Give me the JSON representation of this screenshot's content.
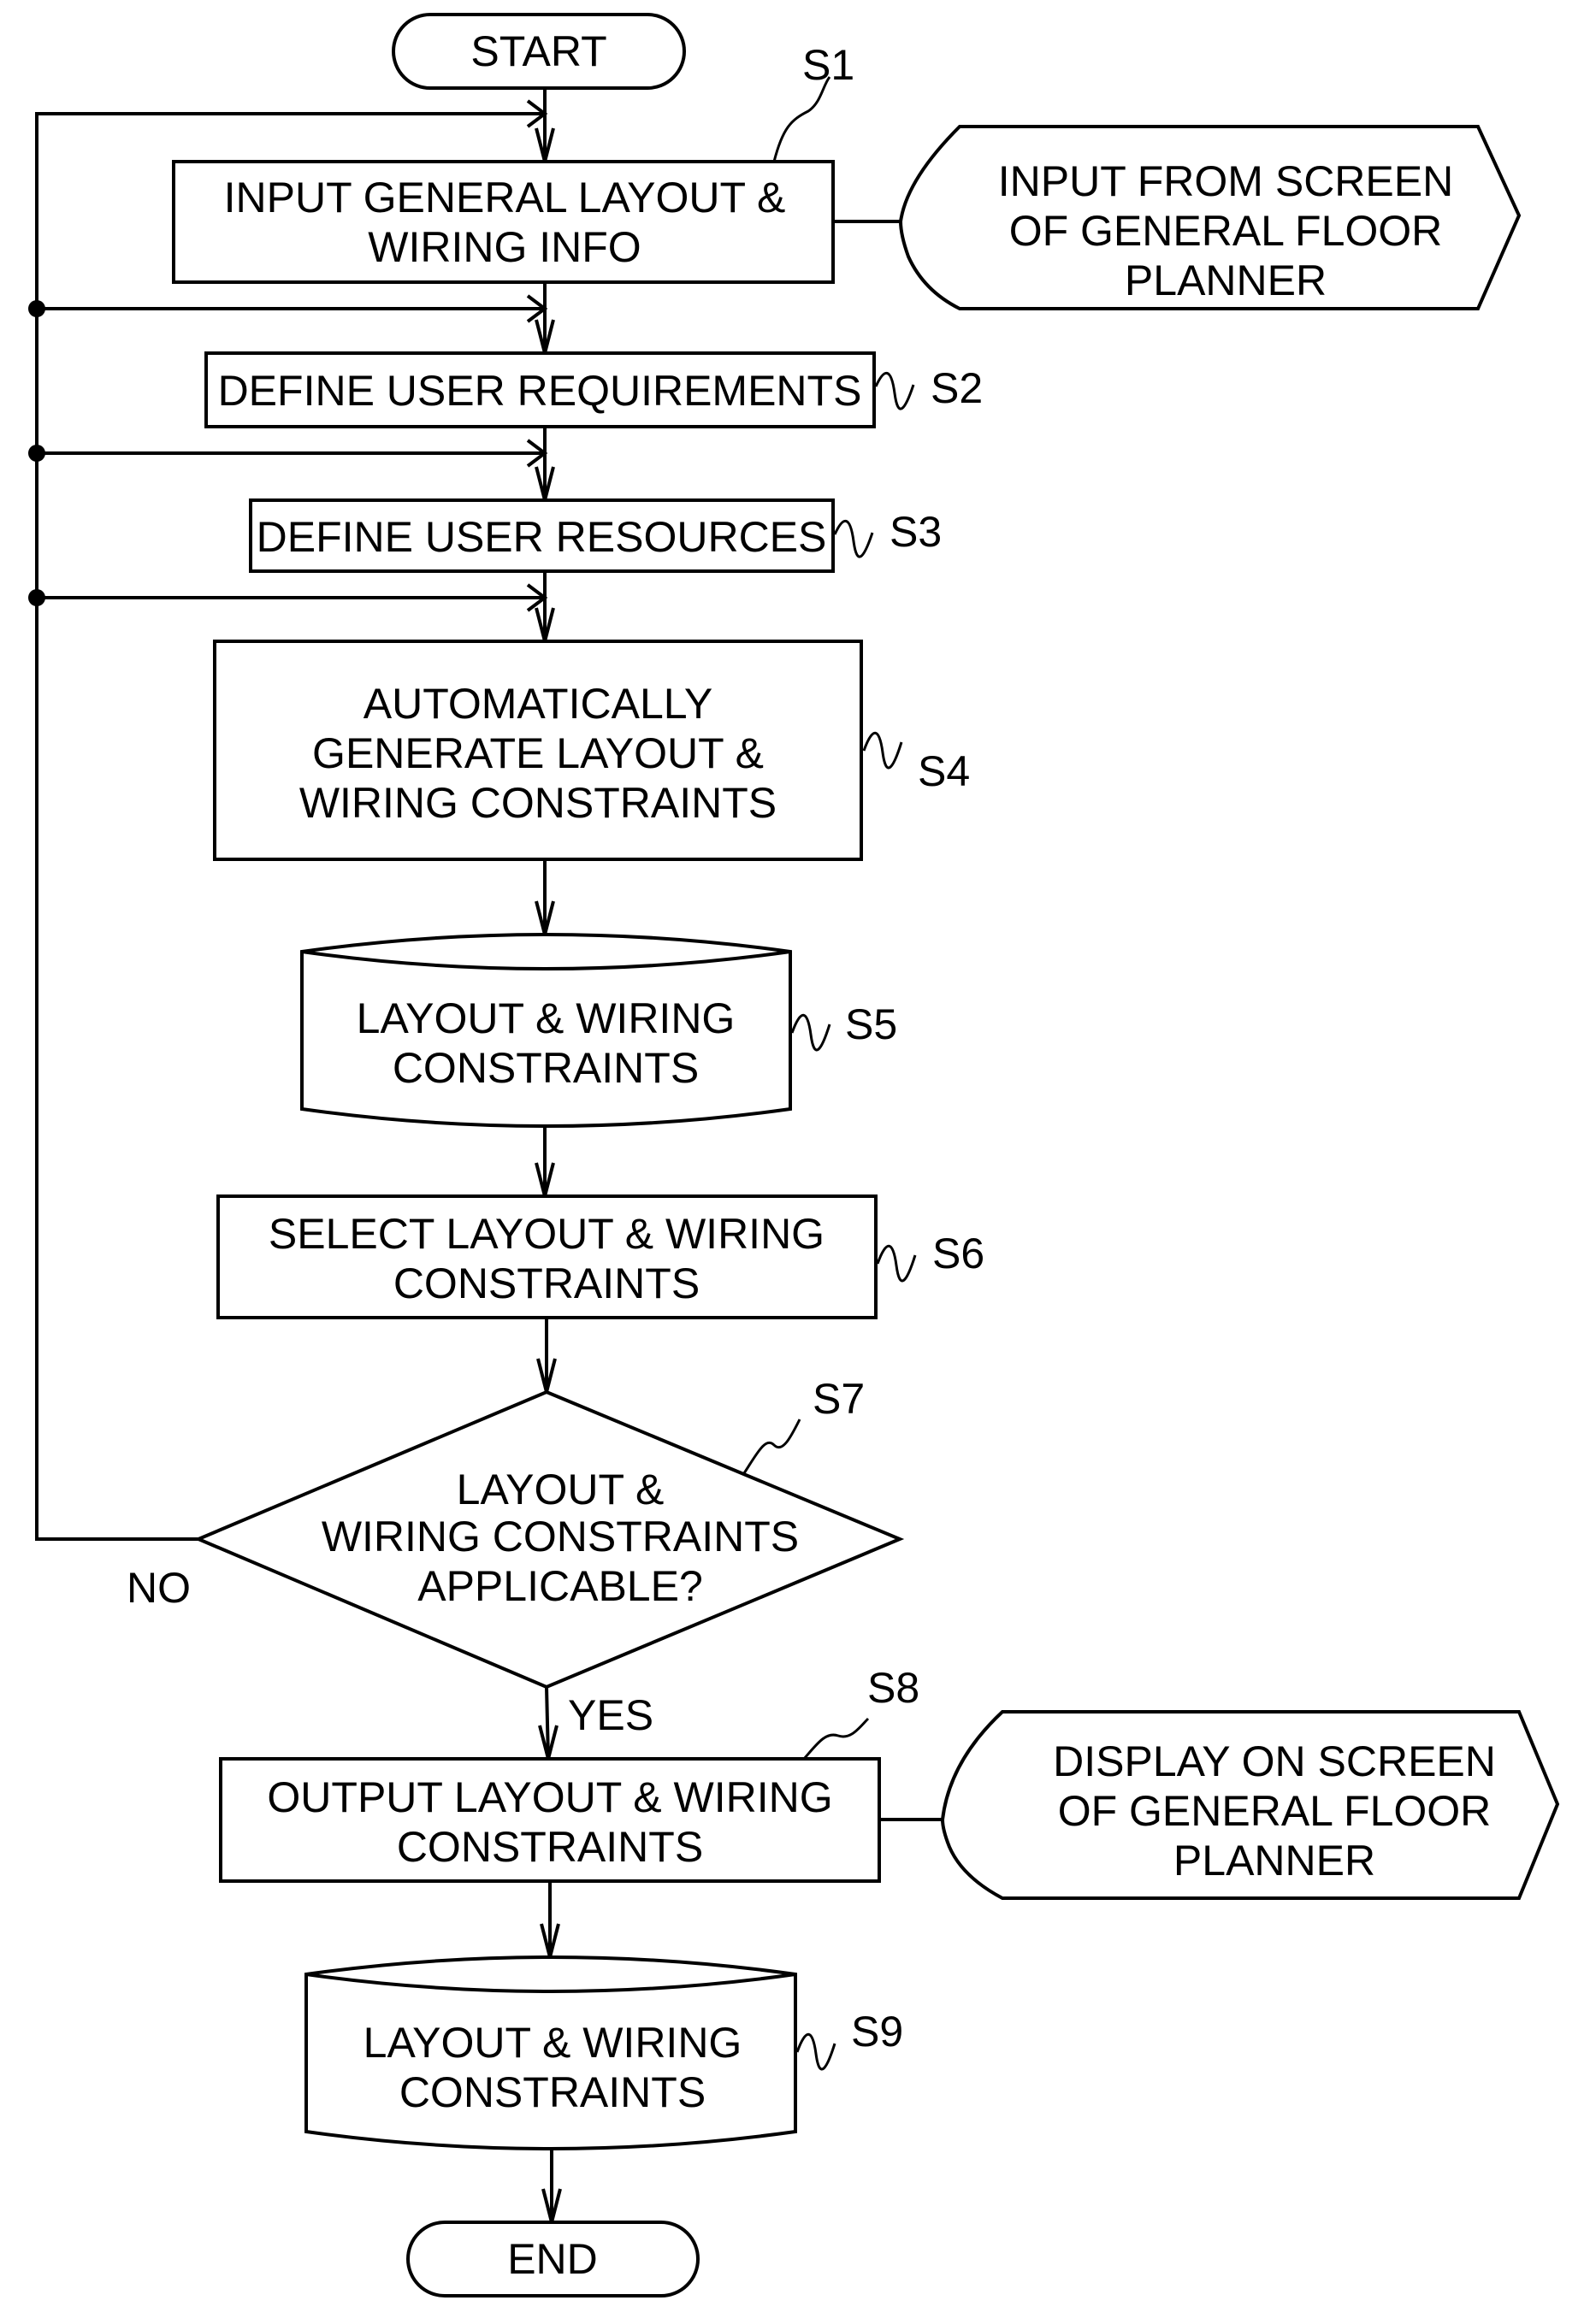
{
  "flowchart": {
    "start": "START",
    "end": "END",
    "steps": [
      {
        "id": "S1",
        "lines": [
          "INPUT GENERAL LAYOUT &",
          "WIRING INFO"
        ]
      },
      {
        "id": "S2",
        "lines": [
          "DEFINE USER REQUIREMENTS"
        ]
      },
      {
        "id": "S3",
        "lines": [
          "DEFINE USER RESOURCES"
        ]
      },
      {
        "id": "S4",
        "lines": [
          "AUTOMATICALLY",
          "GENERATE LAYOUT &",
          "WIRING CONSTRAINTS"
        ]
      },
      {
        "id": "S5",
        "lines": [
          "LAYOUT & WIRING",
          "CONSTRAINTS"
        ]
      },
      {
        "id": "S6",
        "lines": [
          "SELECT LAYOUT & WIRING",
          "CONSTRAINTS"
        ]
      },
      {
        "id": "S7",
        "lines": [
          "LAYOUT &",
          "WIRING CONSTRAINTS",
          "APPLICABLE?"
        ]
      },
      {
        "id": "S8",
        "lines": [
          "OUTPUT LAYOUT & WIRING",
          "CONSTRAINTS"
        ]
      },
      {
        "id": "S9",
        "lines": [
          "LAYOUT & WIRING",
          "CONSTRAINTS"
        ]
      }
    ],
    "input_display": {
      "lines": [
        "INPUT FROM SCREEN",
        "OF GENERAL FLOOR",
        "PLANNER"
      ]
    },
    "output_display": {
      "lines": [
        "DISPLAY ON SCREEN",
        "OF GENERAL FLOOR",
        "PLANNER"
      ]
    },
    "decision_no": "NO",
    "decision_yes": "YES"
  }
}
